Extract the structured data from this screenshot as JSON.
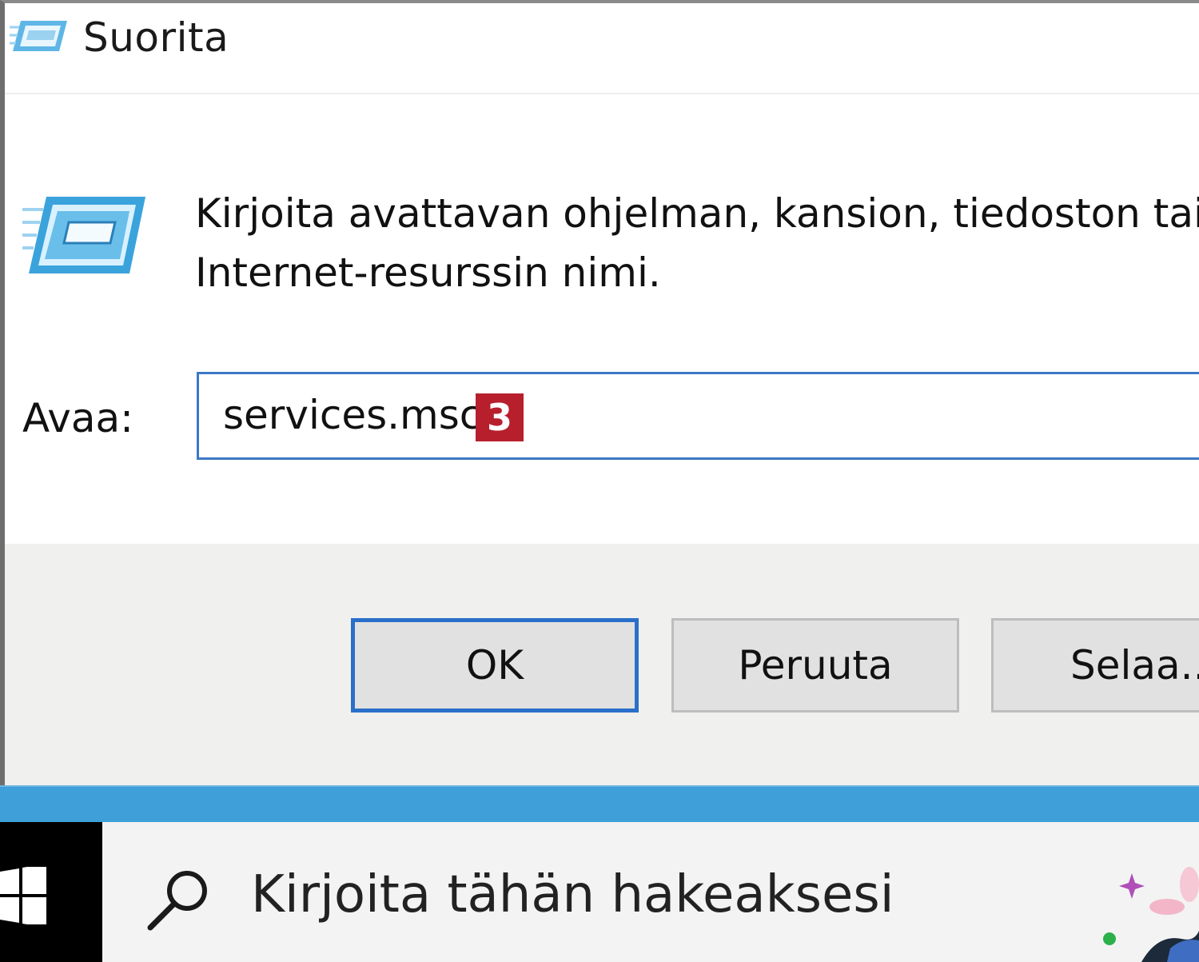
{
  "dialog": {
    "title": "Suorita",
    "prompt_line1": "Kirjoita avattavan ohjelman, kansion, tiedoston tai",
    "prompt_line2": "Internet-resurssin nimi.",
    "open_label": "Avaa:",
    "open_value": "services.msc",
    "step_badge": "3",
    "buttons": {
      "ok": "OK",
      "cancel": "Peruuta",
      "browse": "Selaa..."
    }
  },
  "taskbar": {
    "search_placeholder": "Kirjoita tähän hakeaksesi",
    "start_icon": "windows-logo-icon",
    "search_icon": "search-icon"
  },
  "colors": {
    "accent": "#3e9fd9",
    "focus_border": "#2a6fc9",
    "badge": "#b81f2c"
  }
}
